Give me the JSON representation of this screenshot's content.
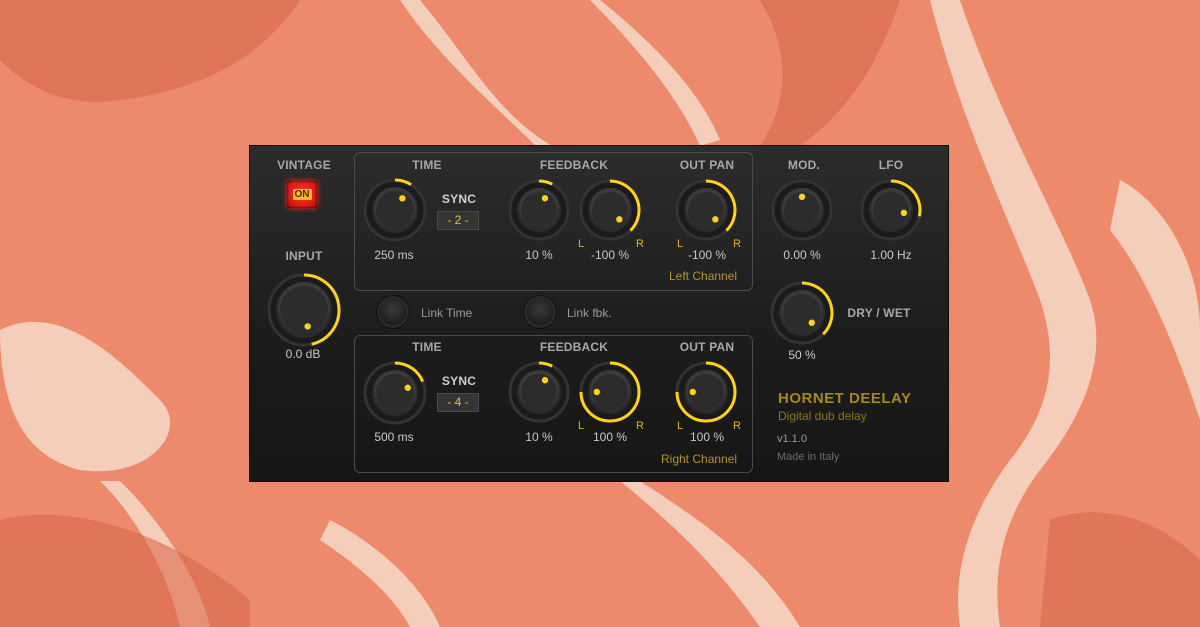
{
  "colors": {
    "accent": "#ffd21a",
    "background": "#ec8a6b",
    "panel": "#1e1e1e",
    "on_button": "#e01d15"
  },
  "vintage": {
    "label": "VINTAGE",
    "button": "ON"
  },
  "input": {
    "label": "INPUT",
    "value": "0.0 dB",
    "level": 0.62
  },
  "left": {
    "time_label": "TIME",
    "time_value": "250 ms",
    "time_level": 0.12,
    "sync_label": "SYNC",
    "sync_value": "- 2 -",
    "feedback_label": "FEEDBACK",
    "feedback_value": "10 %",
    "feedback_level": 0.1,
    "feedback_pan_value": "-100 %",
    "feedback_pan_level": 0.5,
    "outpan_label": "OUT PAN",
    "outpan_value": "-100 %",
    "outpan_level": 0.5,
    "l": "L",
    "r": "R",
    "channel": "Left Channel"
  },
  "link": {
    "time": "Link Time",
    "feedback": "Link fbk."
  },
  "right": {
    "time_label": "TIME",
    "time_value": "500 ms",
    "time_level": 0.25,
    "sync_label": "SYNC",
    "sync_value": "- 4 -",
    "feedback_label": "FEEDBACK",
    "feedback_value": "10 %",
    "feedback_level": 0.1,
    "feedback_pan_value": "100 %",
    "feedback_pan_level": 1.0,
    "outpan_label": "OUT PAN",
    "outpan_value": "100 %",
    "outpan_level": 1.0,
    "l": "L",
    "r": "R",
    "channel": "Right Channel"
  },
  "mod": {
    "label": "MOD.",
    "value": "0.00 %",
    "level": 0.0
  },
  "lfo": {
    "label": "LFO",
    "value": "1.00 Hz",
    "level": 0.38
  },
  "drywet": {
    "label": "DRY / WET",
    "value": "50 %",
    "level": 0.5
  },
  "brand": {
    "name": "HORNET DEELAY",
    "tagline": "Digital dub delay",
    "version": "v1.1.0",
    "origin": "Made in Italy"
  }
}
